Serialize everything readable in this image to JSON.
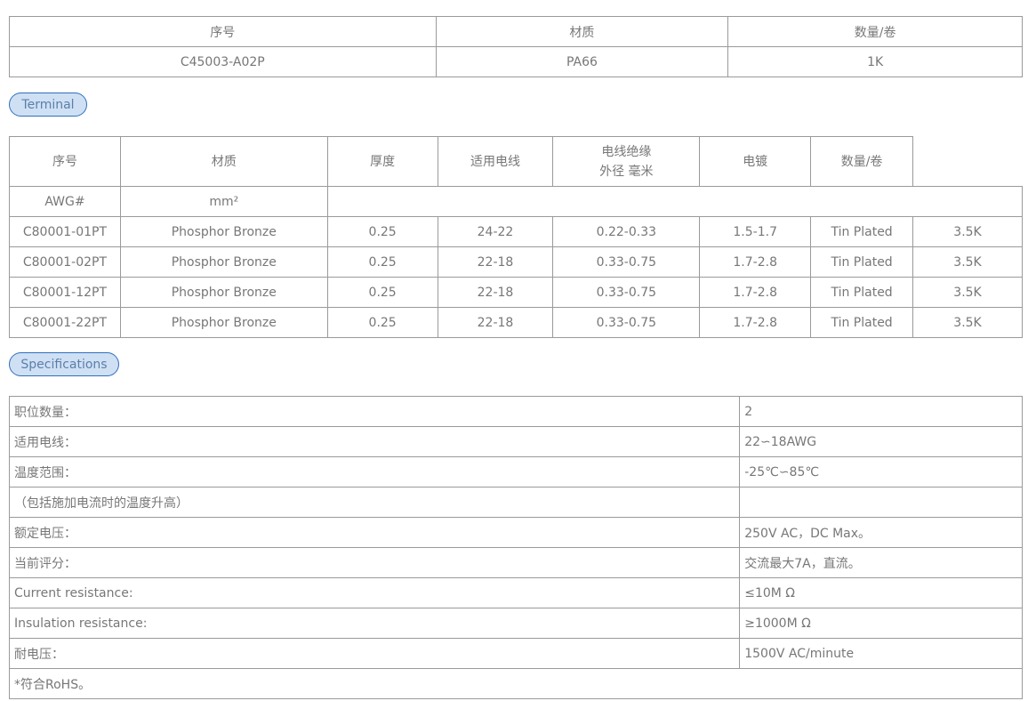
{
  "housing_table": {
    "headers": [
      "序号",
      "材质",
      "数量/卷"
    ],
    "row": [
      "C45003-A02P",
      "PA66",
      "1K"
    ]
  },
  "terminal_label": "Terminal",
  "terminal_table": {
    "headers": [
      "序号",
      "材质",
      "厚度",
      "适用电线",
      "电线绝缘",
      "外径 毫米",
      "电镀",
      "数量/卷"
    ],
    "subheaders": [
      "AWG#",
      "mm²"
    ],
    "rows": [
      [
        "C80001-01PT",
        "Phosphor Bronze",
        "0.25",
        "24-22",
        "0.22-0.33",
        "1.5-1.7",
        "Tin Plated",
        "3.5K"
      ],
      [
        "C80001-02PT",
        "Phosphor Bronze",
        "0.25",
        "22-18",
        "0.33-0.75",
        "1.7-2.8",
        "Tin Plated",
        "3.5K"
      ],
      [
        "C80001-12PT",
        "Phosphor Bronze",
        "0.25",
        "22-18",
        "0.33-0.75",
        "1.7-2.8",
        "Tin Plated",
        "3.5K"
      ],
      [
        "C80001-22PT",
        "Phosphor Bronze",
        "0.25",
        "22-18",
        "0.33-0.75",
        "1.7-2.8",
        "Tin Plated",
        "3.5K"
      ]
    ]
  },
  "specifications_label": "Specifications",
  "spec_table": {
    "rows": [
      [
        "职位数量：",
        "2"
      ],
      [
        "适用电线：",
        "22∽18AWG"
      ],
      [
        "温度范围：",
        "-25℃∽85℃"
      ],
      [
        "（包括施加电流时的温度升高）",
        ""
      ],
      [
        "额定电压：",
        "250V AC，DC Max。"
      ],
      [
        "当前评分：",
        "交流最大7A，直流。"
      ],
      [
        "Current resistance:",
        "≤10M Ω"
      ],
      [
        "Insulation resistance:",
        "≥1000M Ω"
      ],
      [
        "耐电压：",
        "1500V AC/minute"
      ]
    ],
    "footer": "*符合RoHS。"
  }
}
